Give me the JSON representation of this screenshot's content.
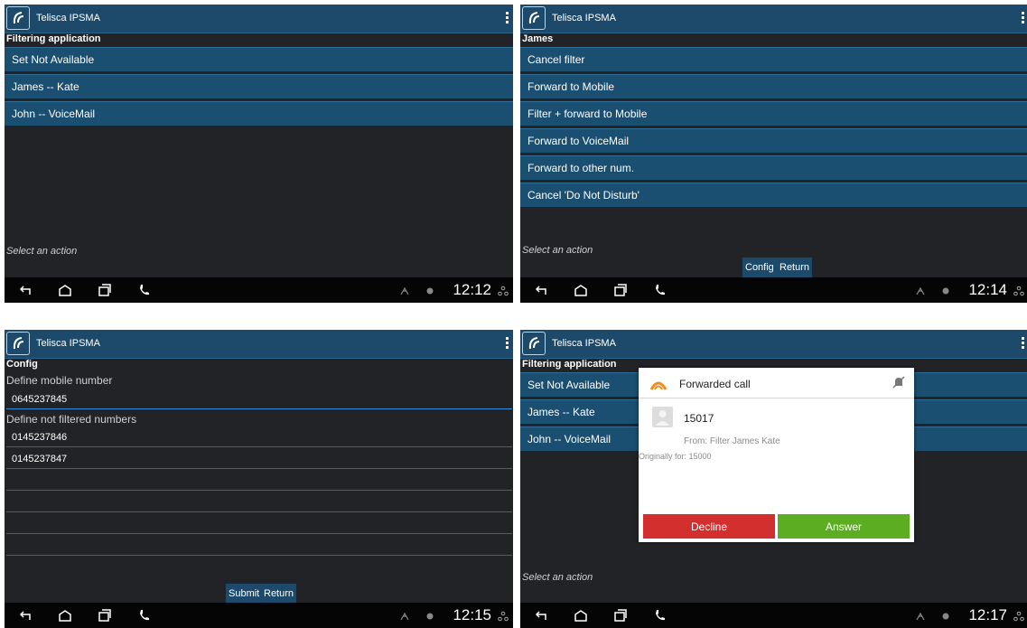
{
  "app_title": "Telisca IPSMA",
  "screens": [
    {
      "subheading": "Filtering application",
      "items": [
        "Set Not Available",
        "James -- Kate",
        "John -- VoiceMail"
      ],
      "status": "Select an action",
      "time": "12:12"
    },
    {
      "subheading": "James",
      "items": [
        "Cancel filter",
        "Forward to Mobile",
        "Filter + forward to Mobile",
        "Forward to VoiceMail",
        "Forward to other num.",
        "Cancel 'Do Not Disturb'"
      ],
      "status": "Select an action",
      "buttons": [
        "Config",
        "Return"
      ],
      "time": "12:14"
    },
    {
      "subheading": "Config",
      "mobile_label": "Define mobile number",
      "mobile_value": "0645237845",
      "not_filtered_label": "Define not filtered numbers",
      "not_filtered_values": [
        "0145237846",
        "0145237847",
        "",
        "",
        "",
        "",
        ""
      ],
      "buttons": [
        "Submit",
        "Return"
      ],
      "time": "12:15"
    },
    {
      "subheading": "Filtering application",
      "items": [
        "Set Not Available",
        "James -- Kate",
        "John -- VoiceMail"
      ],
      "status": "Select an action",
      "time": "12:17",
      "dialog": {
        "title": "Forwarded call",
        "number": "15017",
        "from": "From: Filter James Kate",
        "originally": "Originally for: 15000",
        "decline": "Decline",
        "answer": "Answer",
        "decline_color": "#d32f2f",
        "answer_color": "#5cad22"
      }
    }
  ],
  "colors": {
    "titlebar": "#1d4a6b",
    "list_item": "#1b4f72",
    "background": "#222326",
    "navbar": "#050505"
  }
}
